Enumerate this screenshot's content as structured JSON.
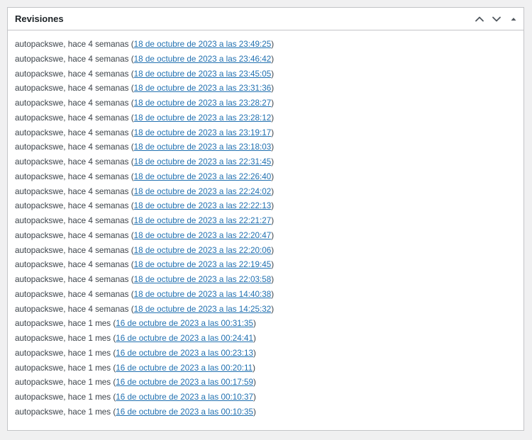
{
  "panel": {
    "title": "Revisiones"
  },
  "icons": {
    "move_up": "chevron-up-icon",
    "move_down": "chevron-down-icon",
    "toggle": "caret-up-icon"
  },
  "colors": {
    "link": "#2271b1",
    "text": "#3c434a",
    "border": "#c3c4c7"
  },
  "revisions": [
    {
      "author": "autopackswe",
      "age": "hace 4 semanas",
      "date": "18 de octubre de 2023 a las 23:49:25"
    },
    {
      "author": "autopackswe",
      "age": "hace 4 semanas",
      "date": "18 de octubre de 2023 a las 23:46:42"
    },
    {
      "author": "autopackswe",
      "age": "hace 4 semanas",
      "date": "18 de octubre de 2023 a las 23:45:05"
    },
    {
      "author": "autopackswe",
      "age": "hace 4 semanas",
      "date": "18 de octubre de 2023 a las 23:31:36"
    },
    {
      "author": "autopackswe",
      "age": "hace 4 semanas",
      "date": "18 de octubre de 2023 a las 23:28:27"
    },
    {
      "author": "autopackswe",
      "age": "hace 4 semanas",
      "date": "18 de octubre de 2023 a las 23:28:12"
    },
    {
      "author": "autopackswe",
      "age": "hace 4 semanas",
      "date": "18 de octubre de 2023 a las 23:19:17"
    },
    {
      "author": "autopackswe",
      "age": "hace 4 semanas",
      "date": "18 de octubre de 2023 a las 23:18:03"
    },
    {
      "author": "autopackswe",
      "age": "hace 4 semanas",
      "date": "18 de octubre de 2023 a las 22:31:45"
    },
    {
      "author": "autopackswe",
      "age": "hace 4 semanas",
      "date": "18 de octubre de 2023 a las 22:26:40"
    },
    {
      "author": "autopackswe",
      "age": "hace 4 semanas",
      "date": "18 de octubre de 2023 a las 22:24:02"
    },
    {
      "author": "autopackswe",
      "age": "hace 4 semanas",
      "date": "18 de octubre de 2023 a las 22:22:13"
    },
    {
      "author": "autopackswe",
      "age": "hace 4 semanas",
      "date": "18 de octubre de 2023 a las 22:21:27"
    },
    {
      "author": "autopackswe",
      "age": "hace 4 semanas",
      "date": "18 de octubre de 2023 a las 22:20:47"
    },
    {
      "author": "autopackswe",
      "age": "hace 4 semanas",
      "date": "18 de octubre de 2023 a las 22:20:06"
    },
    {
      "author": "autopackswe",
      "age": "hace 4 semanas",
      "date": "18 de octubre de 2023 a las 22:19:45"
    },
    {
      "author": "autopackswe",
      "age": "hace 4 semanas",
      "date": "18 de octubre de 2023 a las 22:03:58"
    },
    {
      "author": "autopackswe",
      "age": "hace 4 semanas",
      "date": "18 de octubre de 2023 a las 14:40:38"
    },
    {
      "author": "autopackswe",
      "age": "hace 4 semanas",
      "date": "18 de octubre de 2023 a las 14:25:32"
    },
    {
      "author": "autopackswe",
      "age": "hace 1 mes",
      "date": "16 de octubre de 2023 a las 00:31:35"
    },
    {
      "author": "autopackswe",
      "age": "hace 1 mes",
      "date": "16 de octubre de 2023 a las 00:24:41"
    },
    {
      "author": "autopackswe",
      "age": "hace 1 mes",
      "date": "16 de octubre de 2023 a las 00:23:13"
    },
    {
      "author": "autopackswe",
      "age": "hace 1 mes",
      "date": "16 de octubre de 2023 a las 00:20:11"
    },
    {
      "author": "autopackswe",
      "age": "hace 1 mes",
      "date": "16 de octubre de 2023 a las 00:17:59"
    },
    {
      "author": "autopackswe",
      "age": "hace 1 mes",
      "date": "16 de octubre de 2023 a las 00:10:37"
    },
    {
      "author": "autopackswe",
      "age": "hace 1 mes",
      "date": "16 de octubre de 2023 a las 00:10:35"
    }
  ]
}
